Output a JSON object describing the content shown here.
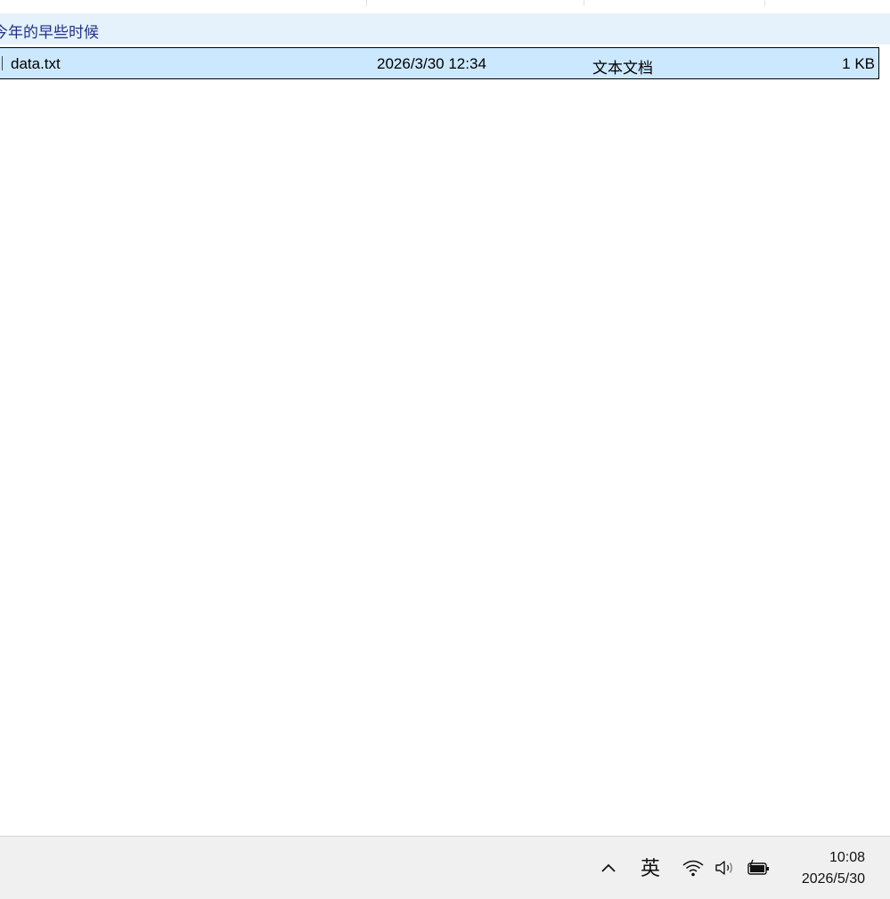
{
  "group": {
    "label": "今年的早些时候"
  },
  "files": [
    {
      "name": "data.txt",
      "date_modified": "2026/3/30 12:34",
      "type": "文本文档",
      "size": "1 KB"
    }
  ],
  "taskbar": {
    "ime_label": "英",
    "time": "10:08",
    "date": "2026/5/30",
    "icons": [
      "chevron-up-icon",
      "wifi-icon",
      "volume-icon",
      "battery-charging-icon"
    ]
  },
  "colors": {
    "group_bg": "#e5f1fb",
    "group_text": "#1e3287",
    "selected_row_bg": "#cce8ff",
    "taskbar_bg": "#f0f0f0"
  }
}
